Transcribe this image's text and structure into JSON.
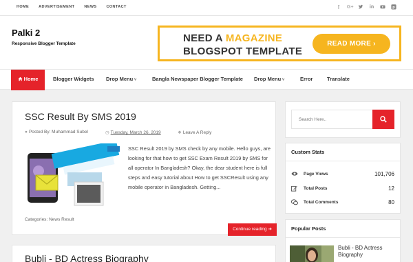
{
  "topbar": {
    "links": [
      "HOME",
      "ADVERTISEMENT",
      "NEWS",
      "CONTACT"
    ],
    "social_icons": [
      "facebook-icon",
      "google-plus-icon",
      "twitter-icon",
      "linkedin-icon",
      "youtube-icon",
      "pinterest-icon"
    ]
  },
  "header": {
    "title": "Palki 2",
    "description": "Responsive Blogger Template",
    "ad": {
      "line1_prefix": "NEED A ",
      "line1_highlight": "MAGAZINE",
      "line2": "BLOGSPOT TEMPLATE",
      "button": "READ MORE ›"
    }
  },
  "nav": {
    "home": "Home",
    "items": [
      "Blogger Widgets",
      "Drop Menu",
      "Bangla Newspaper Blogger Template",
      "Drop Menu",
      "Error",
      "Translate"
    ]
  },
  "post": {
    "title": "SSC Result By SMS 2019",
    "author": "Posted By: Muhammad Subel",
    "date": "Tuesday, March 26, 2019",
    "comment": "Leave A Reply",
    "excerpt": "SSC Result 2019 by SMS check by any mobile. Hello guys, are looking for that how to get SSC Exam Result 2019 by SMS for all operator In Bangladesh? Okay, the dear student here is full steps and easy tutorial about How to get SSCResult using any mobile operator in Bangladesh. Getting...",
    "categories_label": "Categories:",
    "categories": [
      "News",
      "Result"
    ],
    "read_more": "Continue reading"
  },
  "post2": {
    "title": "Bubli - BD Actress Biography"
  },
  "sidebar": {
    "search_placeholder": "Search Here..",
    "stats_title": "Custom Stats",
    "stats": [
      {
        "label": "Page Views",
        "value": "101,706",
        "icon": "eye-icon"
      },
      {
        "label": "Total Posts",
        "value": "12",
        "icon": "edit-icon"
      },
      {
        "label": "Total Comments",
        "value": "80",
        "icon": "comments-icon"
      }
    ],
    "popular_title": "Popular Posts",
    "popular_item": "Bubli - BD Actress Biography"
  },
  "colors": {
    "accent": "#e5232a",
    "ad_yellow": "#f6b51f",
    "background": "#f0f0f0"
  }
}
